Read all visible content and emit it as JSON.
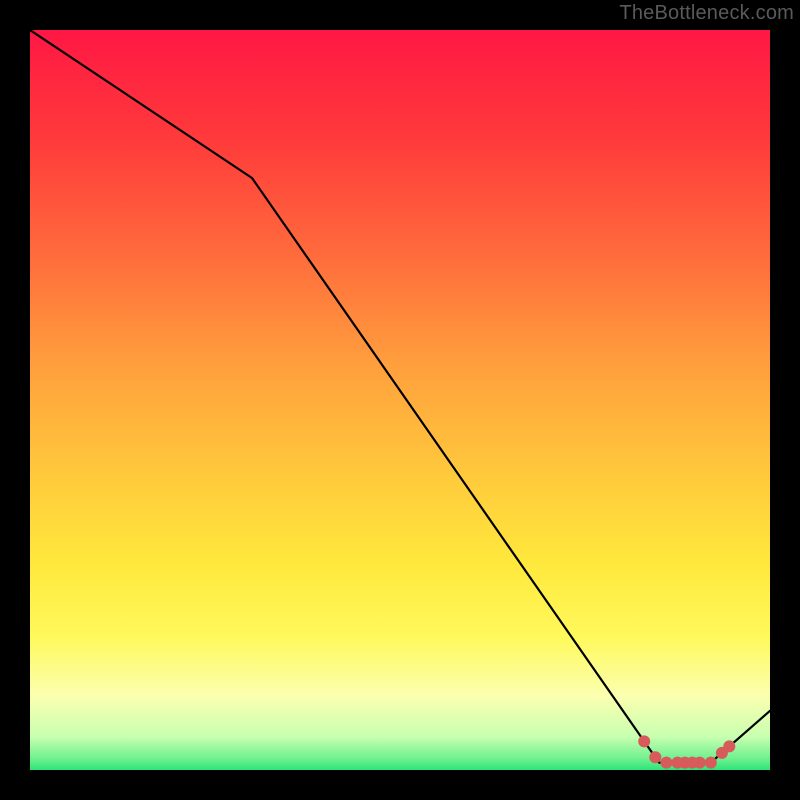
{
  "attribution": "TheBottleneck.com",
  "chart_data": {
    "type": "line",
    "title": "",
    "xlabel": "",
    "ylabel": "",
    "xlim": [
      0,
      100
    ],
    "ylim": [
      0,
      100
    ],
    "series": [
      {
        "name": "bottleneck-curve",
        "x": [
          0,
          30,
          85,
          92,
          100
        ],
        "values": [
          100,
          80,
          1,
          1,
          8
        ]
      }
    ],
    "gradient_stops": [
      {
        "offset": 0.0,
        "color": "#ff1744"
      },
      {
        "offset": 0.15,
        "color": "#ff3b3b"
      },
      {
        "offset": 0.3,
        "color": "#ff6a3c"
      },
      {
        "offset": 0.45,
        "color": "#ff9e3d"
      },
      {
        "offset": 0.6,
        "color": "#ffc93c"
      },
      {
        "offset": 0.72,
        "color": "#ffe83c"
      },
      {
        "offset": 0.82,
        "color": "#fff95b"
      },
      {
        "offset": 0.9,
        "color": "#fbffb0"
      },
      {
        "offset": 0.955,
        "color": "#c8ffb0"
      },
      {
        "offset": 0.985,
        "color": "#6ef08e"
      },
      {
        "offset": 1.0,
        "color": "#2ee37a"
      }
    ],
    "markers": {
      "name": "optimal-range-markers",
      "color": "#d85a5a",
      "x": [
        83,
        84.5,
        86,
        87.5,
        88.5,
        89.5,
        90.5,
        92,
        93.5,
        94.5
      ],
      "y_hint": "on-curve-at-bottom",
      "radius_px": 6
    },
    "axes_visible": false,
    "grid": false
  }
}
